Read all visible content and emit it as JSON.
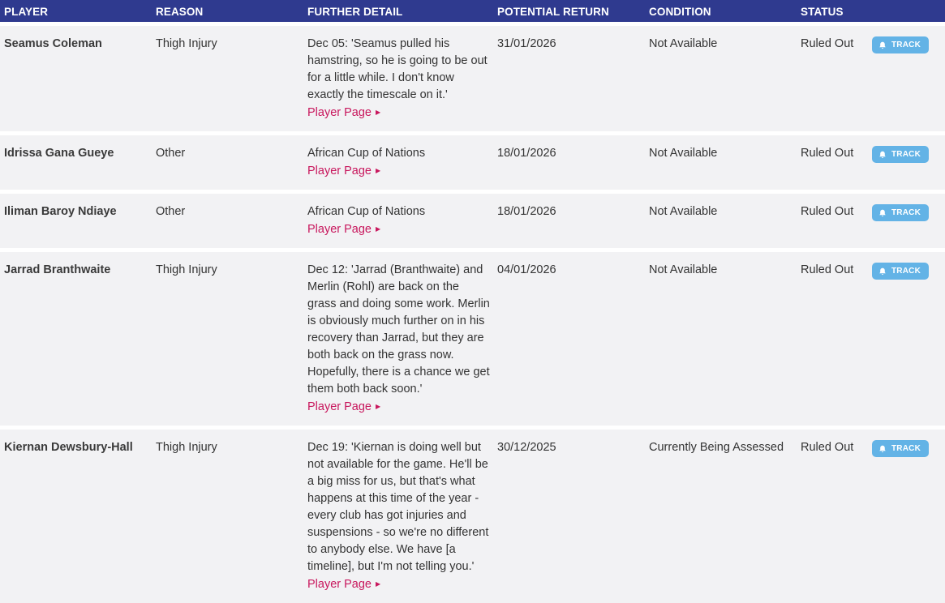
{
  "columns": {
    "player": "PLAYER",
    "reason": "REASON",
    "detail": "FURTHER DETAIL",
    "return": "POTENTIAL RETURN",
    "condition": "CONDITION",
    "status": "STATUS"
  },
  "player_page_label": "Player Page",
  "track_label": "TRACK",
  "accent_colors": {
    "header_bg": "#2f3a8f",
    "link": "#c8175d",
    "track_button": "#63b3e6"
  },
  "rows": [
    {
      "player": "Seamus Coleman",
      "reason": "Thigh Injury",
      "detail": "Dec 05: 'Seamus pulled his hamstring, so he is going to be out for a little while. I don't know exactly the timescale on it.'",
      "return": "31/01/2026",
      "condition": "Not Available",
      "status": "Ruled Out"
    },
    {
      "player": "Idrissa Gana Gueye",
      "reason": "Other",
      "detail": "African Cup of Nations",
      "return": "18/01/2026",
      "condition": "Not Available",
      "status": "Ruled Out"
    },
    {
      "player": "Iliman Baroy Ndiaye",
      "reason": "Other",
      "detail": "African Cup of Nations",
      "return": "18/01/2026",
      "condition": "Not Available",
      "status": "Ruled Out"
    },
    {
      "player": "Jarrad Branthwaite",
      "reason": "Thigh Injury",
      "detail": "Dec 12: 'Jarrad (Branthwaite) and Merlin (Rohl) are back on the grass and doing some work. Merlin is obviously much further on in his recovery than Jarrad, but they are both back on the grass now. Hopefully, there is a chance we get them both back soon.'",
      "return": "04/01/2026",
      "condition": "Not Available",
      "status": "Ruled Out"
    },
    {
      "player": "Kiernan Dewsbury-Hall",
      "reason": "Thigh Injury",
      "detail": "Dec 19: 'Kiernan is doing well but not available for the game. He'll be a big miss for us, but that's what happens at this time of the year - every club has got injuries and suspensions - so we're no different to anybody else. We have [a timeline], but I'm not telling you.'",
      "return": "30/12/2025",
      "condition": "Currently Being Assessed",
      "status": "Ruled Out"
    }
  ]
}
